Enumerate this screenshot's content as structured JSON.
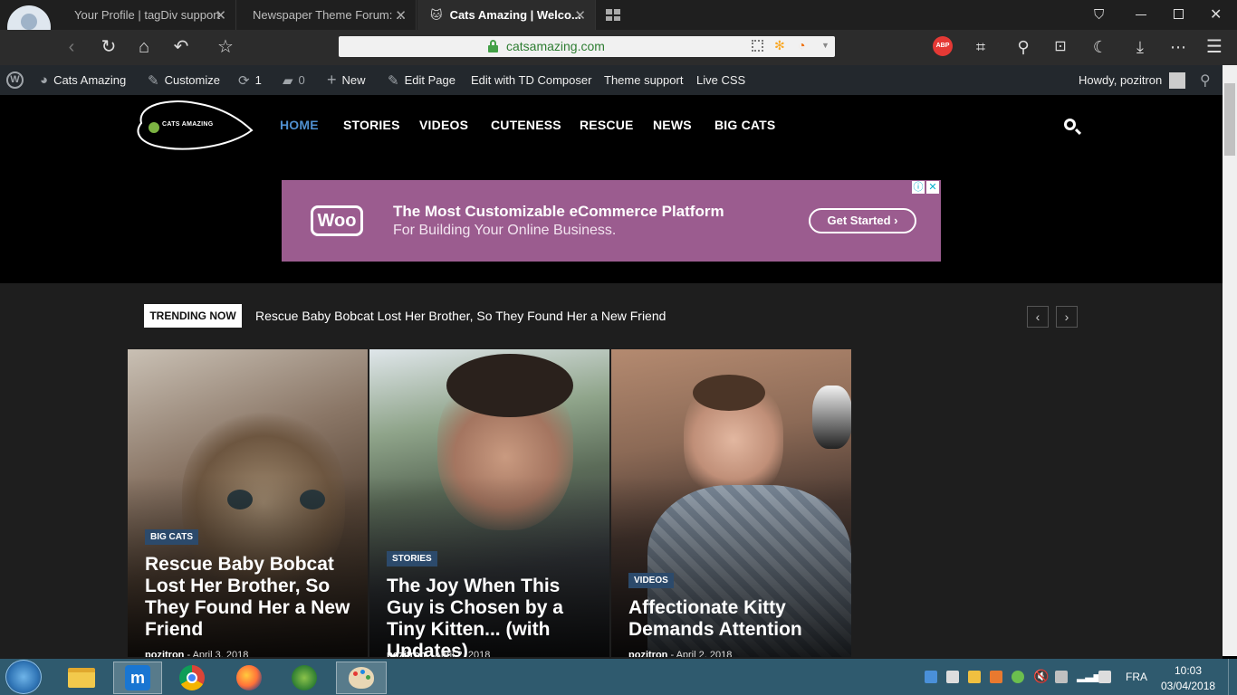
{
  "browser": {
    "tabs": [
      {
        "title": "Your Profile | tagDiv support"
      },
      {
        "title": "Newspaper Theme Forum: ..."
      },
      {
        "title": "Cats Amazing | Welco..."
      }
    ],
    "url": "catsamazing.com",
    "abp_label": "ABP"
  },
  "wp_admin_bar": {
    "site_name": "Cats Amazing",
    "customize": "Customize",
    "updates_count": "1",
    "comments_count": "0",
    "new": "New",
    "edit_page": "Edit Page",
    "edit_td": "Edit with TD Composer",
    "theme_support": "Theme support",
    "live_css": "Live CSS",
    "howdy": "Howdy, pozitron"
  },
  "site": {
    "logo_text": "CATS AMAZING",
    "menu": [
      "HOME",
      "STORIES",
      "VIDEOS",
      "CUTENESS",
      "RESCUE",
      "NEWS",
      "BIG CATS"
    ],
    "ad": {
      "brand": "Woo",
      "headline": "The Most Customizable eCommerce Platform",
      "subline": "For Building Your Online Business.",
      "cta": "Get Started"
    },
    "trending": {
      "label": "TRENDING NOW",
      "headline": "Rescue Baby Bobcat Lost Her Brother, So They Found Her a New Friend"
    },
    "cards": [
      {
        "category": "BIG CATS",
        "title": "Rescue Baby Bobcat Lost Her Brother, So They Found Her a New Friend",
        "author": "pozitron",
        "date": "April 3, 2018"
      },
      {
        "category": "STORIES",
        "title": "The Joy When This Guy is Chosen by a Tiny Kitten... (with Updates)",
        "author": "pozitron",
        "date": "April 2, 2018"
      },
      {
        "category": "VIDEOS",
        "title": "Affectionate Kitty Demands Attention",
        "author": "pozitron",
        "date": "April 2, 2018"
      }
    ]
  },
  "taskbar": {
    "language": "FRA",
    "time": "10:03",
    "date": "03/04/2018"
  }
}
